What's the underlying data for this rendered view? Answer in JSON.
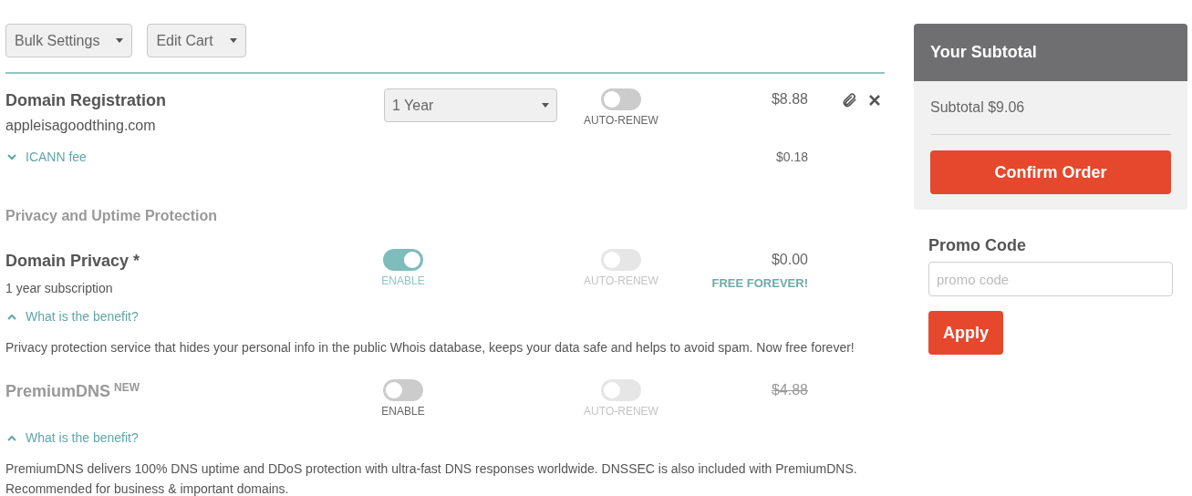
{
  "toolbar": [
    {
      "label": "Bulk Settings"
    },
    {
      "label": "Edit Cart"
    }
  ],
  "registration": {
    "title": "Domain Registration",
    "domain": "appleisagoodthing.com",
    "period": "1 Year",
    "auto_renew": {
      "label": "AUTO-RENEW",
      "on": false,
      "disabled": false
    },
    "price": "$8.88",
    "fee": {
      "label": "ICANN fee",
      "expanded": false,
      "price": "$0.18"
    }
  },
  "section_title": "Privacy and Uptime Protection",
  "products": [
    {
      "name": "Domain Privacy *",
      "subtitle": "1 year subscription",
      "enable": {
        "label": "ENABLE",
        "on": true,
        "disabled": false
      },
      "auto_renew": {
        "label": "AUTO-RENEW",
        "on": false,
        "disabled": true
      },
      "price": "$0.00",
      "struck": false,
      "note": "FREE FOREVER!",
      "benefit": {
        "label": "What is the benefit?",
        "expanded": true
      },
      "description": "Privacy protection service that hides your personal info in the public Whois database, keeps your data safe and helps to avoid spam. Now free forever!"
    },
    {
      "name": "PremiumDNS",
      "badge": "NEW",
      "enable": {
        "label": "ENABLE",
        "on": false,
        "disabled": false
      },
      "auto_renew": {
        "label": "AUTO-RENEW",
        "on": false,
        "disabled": true
      },
      "price": "$4.88",
      "struck": true,
      "benefit": {
        "label": "What is the benefit?",
        "expanded": true
      },
      "description": "PremiumDNS delivers 100% DNS uptime and DDoS protection with ultra-fast DNS responses worldwide. DNSSEC is also included with PremiumDNS. Recommended for business & important domains."
    }
  ],
  "summary": {
    "title": "Your Subtotal",
    "subtotal": "Subtotal $9.06",
    "confirm": "Confirm Order"
  },
  "promo": {
    "label": "Promo Code",
    "placeholder": "promo code",
    "button": "Apply"
  }
}
